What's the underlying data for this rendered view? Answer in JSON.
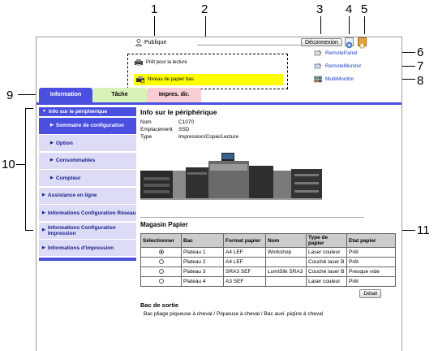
{
  "callouts": [
    "1",
    "2",
    "3",
    "4",
    "5",
    "6",
    "7",
    "8",
    "9",
    "10",
    "11"
  ],
  "header": {
    "user_label": "Publique",
    "disconnect_label": "Déconnexion"
  },
  "status": {
    "line1": "Prêt pour la lecture",
    "line2": "Niveau de papier bas",
    "line2_color": "#ffff00"
  },
  "right_links": [
    "RemotePanel",
    "RemoteMonitor",
    "MultiMonitor"
  ],
  "tabs": [
    "Information",
    "Tâche",
    "Impres. dir."
  ],
  "sidebar": {
    "items": [
      "Info sur le périphérique",
      "Sommaire de configuration",
      "Option",
      "Consommables",
      "Compteur",
      "Assistance en ligne",
      "Informations Configuration Réseau",
      "Informations Configuration Impression",
      "Informations d'impression"
    ]
  },
  "main": {
    "title": "Info sur le périphérique",
    "info": [
      {
        "label": "Nom",
        "value": "C1070"
      },
      {
        "label": "Emplacement",
        "value": "SSD"
      },
      {
        "label": "Type",
        "value": "Impression/Copie/Lecture"
      }
    ],
    "paper_title": "Magasin Papier",
    "table_headers": [
      "Sélectionner",
      "Bac",
      "Format papier",
      "Nom",
      "Type de papier",
      "Etat papier"
    ],
    "rows": [
      {
        "selected": true,
        "bac": "Plateau 1",
        "format": "A4 LEF",
        "nom": "Workshop",
        "type": "Laser couleur",
        "etat": "Prêt"
      },
      {
        "selected": false,
        "bac": "Plateau 2",
        "format": "A4 LEF",
        "nom": "",
        "type": "Couché laser B",
        "etat": "Prêt"
      },
      {
        "selected": false,
        "bac": "Plateau 3",
        "format": "SRA3 SEF",
        "nom": "LumiSilk SRA3",
        "type": "Couché laser B",
        "etat": "Presque vide"
      },
      {
        "selected": false,
        "bac": "Plateau 4",
        "format": "A3 SEF",
        "nom": "",
        "type": "Laser couleur",
        "etat": "Prêt"
      }
    ],
    "detail_label": "Détail",
    "output_title": "Bac de sortie",
    "output_text": "Bac pliage piqueuse à cheval / Piqueuse à cheval / Bac auxi. piqûre à cheval"
  },
  "colors": {
    "accent": "#4a4fe0",
    "tab_tache": "#d8f3b8",
    "tab_impres": "#f8cdd4",
    "sidebar_bg": "#dcdcf6"
  }
}
